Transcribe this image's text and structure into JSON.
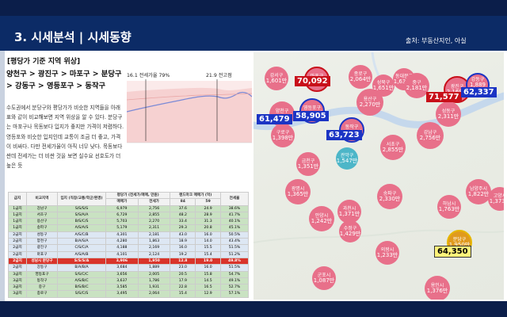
{
  "header": {
    "title": "3. 시세분석 | 시세동향",
    "source": "출처: 부동산지인, 아실"
  },
  "left": {
    "section_title": "[평당가 기준 지역 위상]",
    "regions": [
      "양천구 > 광진구 > 마포구 > 분당구",
      "> 강동구 > 영등포구 > 동작구"
    ],
    "description": "수도권에서 분당구와 평당가가 비슷한 지역들을 아래 표와 같이 비교해보면 지역 위상을 알 수 있다. 분당구는 마포구나 목동보다 입지가 좋지만 가격이 저렴하다. 영등포와 비슷한 입지인데 교통이 조금 더 좋고, 가격이 비싸다. 다만 전세가율이 아직 너무 낮다. 목동보다 싼데 전세가는 더 비싼 것을 보면 실수요 선호도가 더 높은 듯"
  },
  "trend": {
    "label_left": "16.1 전세가율 79%",
    "label_right": "21.9 전고점"
  },
  "table": {
    "headers_top": [
      "급지",
      "비교지역",
      "입지\n(직장/교통/학군/환경)",
      "평당가 (전세가/매매, 만원)",
      "",
      "랜드마크 매매가 (억)",
      "",
      "전세율"
    ],
    "headers_sub": [
      "",
      "",
      "",
      "매매가",
      "전세가",
      "84",
      "59",
      ""
    ],
    "rows": [
      [
        "1급지",
        "강남구",
        "S/S/S/S",
        "6,979",
        "2,756",
        "37.6",
        "24.9",
        "38.6%"
      ],
      [
        "1급지",
        "서초구",
        "S/S/A/A",
        "6,729",
        "2,855",
        "48.2",
        "28.9",
        "41.7%"
      ],
      [
        "1급지",
        "용산구",
        "B/S/C/S",
        "5,703",
        "2,270",
        "33.4",
        "31.3",
        "40.1%"
      ],
      [
        "1급지",
        "송파구",
        "A/S/A/S",
        "5,179",
        "2,311",
        "29.3",
        "20.8",
        "45.1%"
      ],
      [
        "2급지",
        "성동구",
        "A/S/C/B",
        "4,301",
        "2,181",
        "43.0",
        "16.0",
        "50.5%"
      ],
      [
        "2급지",
        "양천구",
        "B/A/S/A",
        "4,280",
        "1,863",
        "18.9",
        "14.0",
        "43.4%"
      ],
      [
        "2급지",
        "광진구",
        "C/S/C/A",
        "4,188",
        "2,169",
        "16.0",
        "15.5",
        "51.5%"
      ],
      [
        "2급지",
        "마포구",
        "A/S/A/B",
        "4,101",
        "2,124",
        "19.2",
        "15.4",
        "51.2%"
      ],
      [
        "2급지",
        "성남시 분당구",
        "S/S/S/A",
        "3,906",
        "1,950",
        "12.8",
        "19.0",
        "49.8%"
      ],
      [
        "2급지",
        "강동구",
        "B/A/B/A",
        "3,684",
        "1,889",
        "23.0",
        "16.0",
        "51.5%"
      ],
      [
        "3급지",
        "영등포구",
        "S/S/C/C",
        "3,656",
        "2,005",
        "20.5",
        "15.8",
        "54.7%"
      ],
      [
        "3급지",
        "동작구",
        "A/S/B/C",
        "3,637",
        "1,786",
        "17.9",
        "14.5",
        "49.1%"
      ],
      [
        "3급지",
        "중구",
        "B/S/B/C",
        "3,585",
        "1,931",
        "22.8",
        "16.5",
        "52.7%"
      ],
      [
        "3급지",
        "종로구",
        "S/S/C/S",
        "3,495",
        "2,064",
        "15.4",
        "12.9",
        "57.1%"
      ]
    ]
  },
  "map": {
    "bubbles": [
      {
        "name": "강서구",
        "value": "1,601만"
      },
      {
        "name": "마포구",
        "value": "2,124만"
      },
      {
        "name": "종로구",
        "value": "2,064만"
      },
      {
        "name": "성북구",
        "value": "1,651만"
      },
      {
        "name": "동대문구",
        "value": "1,638만"
      },
      {
        "name": "중구",
        "value": "2,181만"
      },
      {
        "name": "광진구",
        "value": "2,169만"
      },
      {
        "name": "강동구",
        "value": "1,889만"
      },
      {
        "name": "용산구",
        "value": "2,270만"
      },
      {
        "name": "성동구",
        "value": "2,311만"
      },
      {
        "name": "양천구",
        "value": "1,863만"
      },
      {
        "name": "영등포구",
        "value": "1,785만"
      },
      {
        "name": "강남구",
        "value": "2,756만"
      },
      {
        "name": "서초구",
        "value": "2,855만"
      },
      {
        "name": "동작구",
        "value": "1,931만"
      },
      {
        "name": "구로구",
        "value": "1,398만"
      },
      {
        "name": "금천구",
        "value": "1,351만"
      },
      {
        "name": "관악구",
        "value": "1,547만"
      },
      {
        "name": "송파구",
        "value": "2,330만"
      },
      {
        "name": "광명시",
        "value": "1,365만"
      },
      {
        "name": "과천시",
        "value": "1,371만"
      },
      {
        "name": "하남시",
        "value": "1,763만"
      },
      {
        "name": "남양주시",
        "value": "1,822만"
      },
      {
        "name": "고양시",
        "value": "1,373만"
      },
      {
        "name": "안양시",
        "value": "1,242만"
      },
      {
        "name": "수정구",
        "value": "1,429만"
      },
      {
        "name": "의왕시",
        "value": "1,233만"
      },
      {
        "name": "분당구",
        "value": "1,950만"
      },
      {
        "name": "군포시",
        "value": "1,087만"
      },
      {
        "name": "용인시",
        "value": "1,376만"
      }
    ],
    "callouts": [
      {
        "value": "70,092",
        "color": "red"
      },
      {
        "value": "71,577",
        "color": "red"
      },
      {
        "value": "62,337",
        "color": "blue"
      },
      {
        "value": "61,479",
        "color": "blue"
      },
      {
        "value": "58,905",
        "color": "blue"
      },
      {
        "value": "63,723",
        "color": "blue"
      },
      {
        "value": "64,350",
        "color": "yellow"
      }
    ]
  }
}
